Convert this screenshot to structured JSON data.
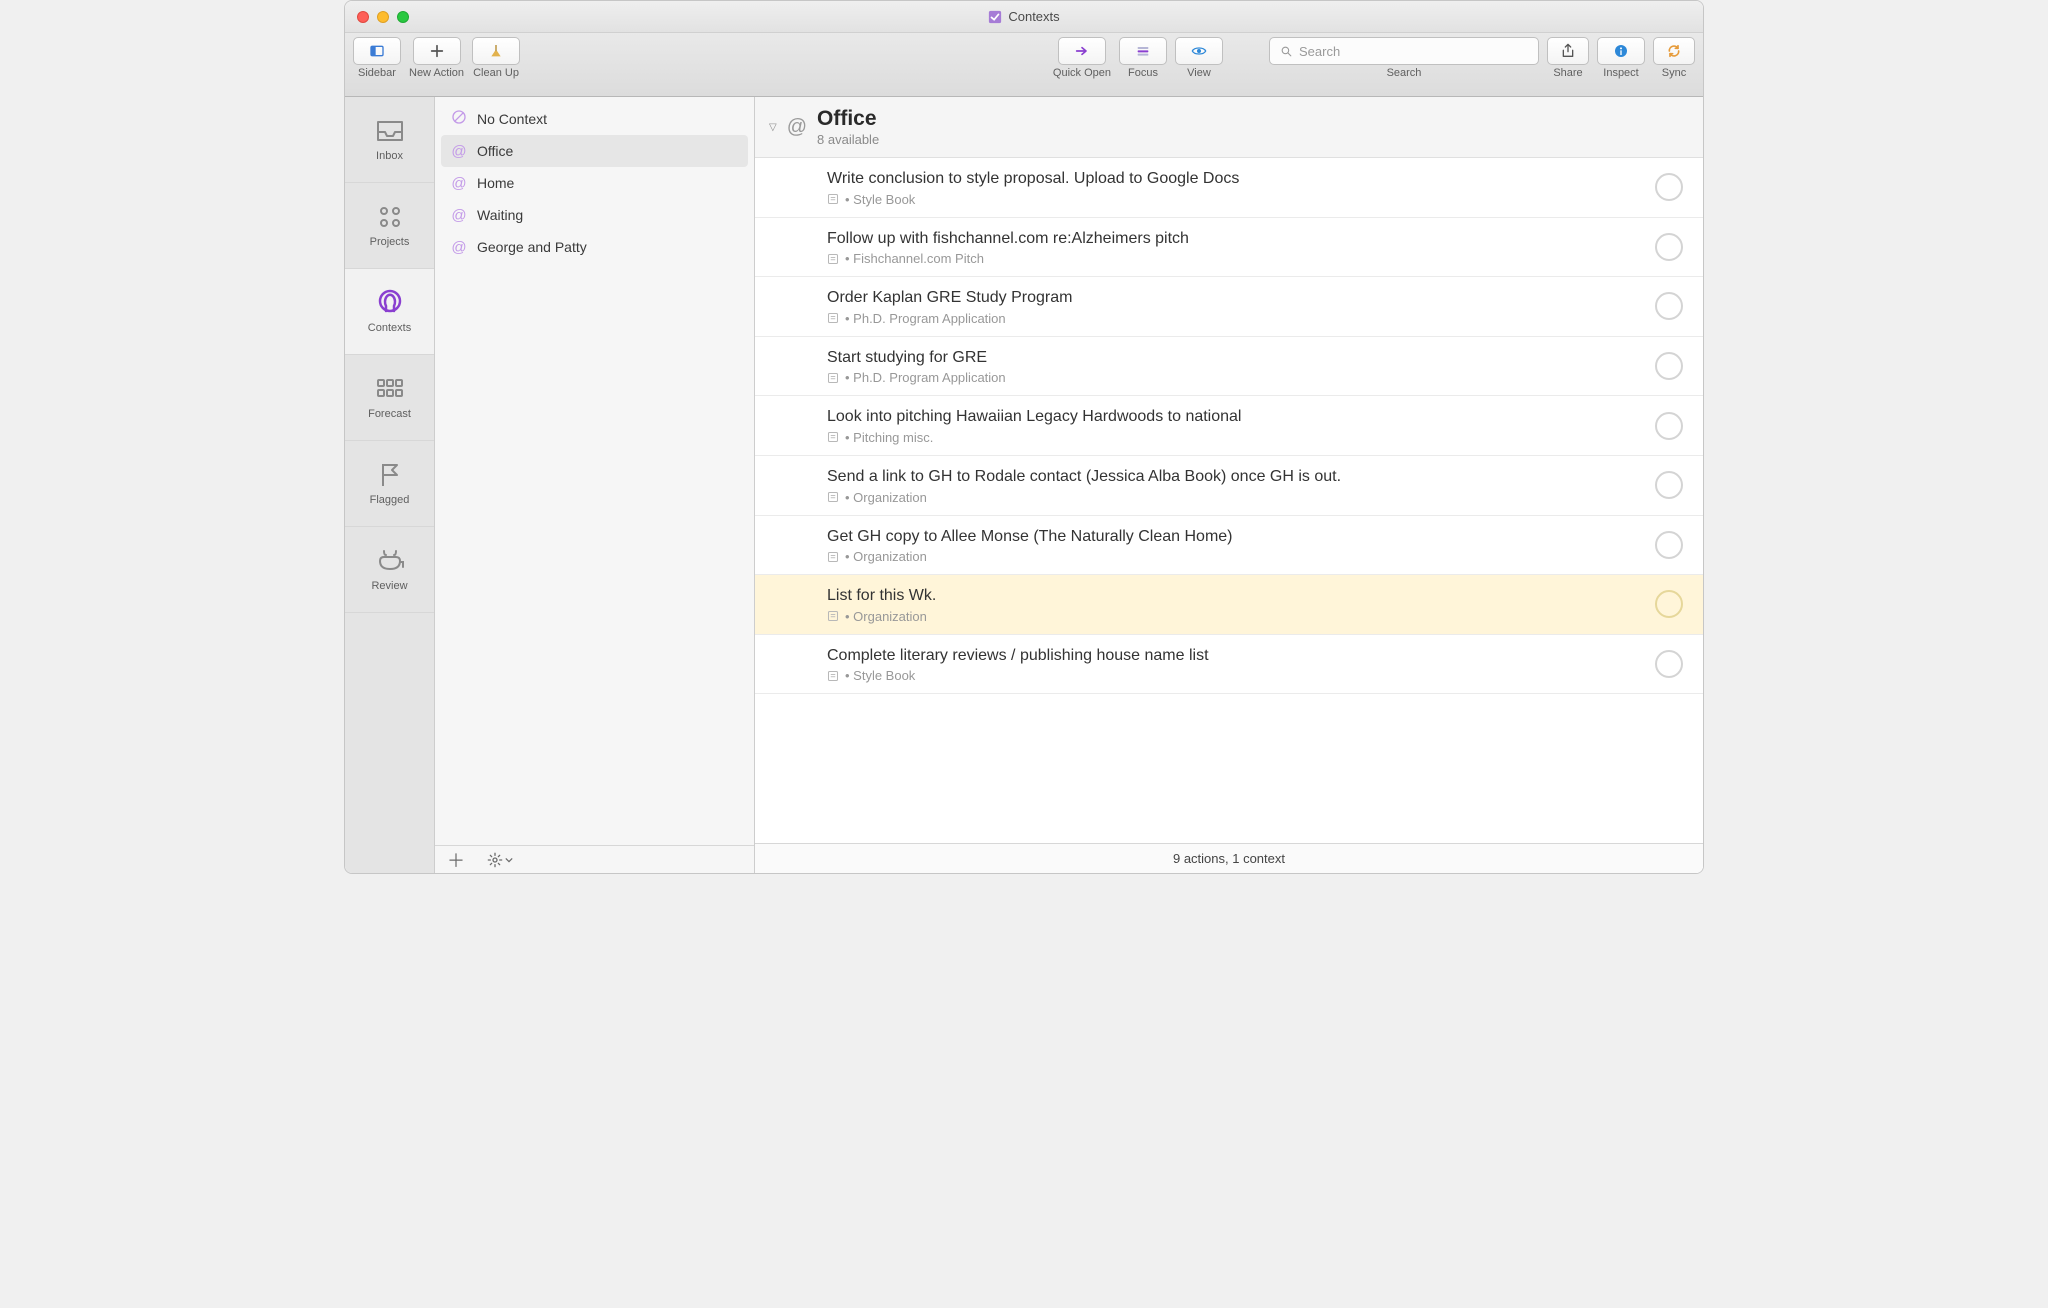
{
  "window": {
    "title": "Contexts"
  },
  "toolbar": {
    "sidebar": "Sidebar",
    "new_action": "New Action",
    "clean_up": "Clean Up",
    "quick_open": "Quick Open",
    "focus": "Focus",
    "view": "View",
    "search_label": "Search",
    "search_placeholder": "Search",
    "share": "Share",
    "inspect": "Inspect",
    "sync": "Sync"
  },
  "rail": {
    "items": [
      {
        "label": "Inbox"
      },
      {
        "label": "Projects"
      },
      {
        "label": "Contexts"
      },
      {
        "label": "Forecast"
      },
      {
        "label": "Flagged"
      },
      {
        "label": "Review"
      }
    ]
  },
  "sidebar": {
    "contexts": [
      {
        "label": "No Context",
        "no_context": true
      },
      {
        "label": "Office",
        "selected": true
      },
      {
        "label": "Home"
      },
      {
        "label": "Waiting"
      },
      {
        "label": "George and Patty"
      }
    ]
  },
  "main": {
    "context_title": "Office",
    "context_subtitle": "8 available",
    "tasks": [
      {
        "title": "Write conclusion to style proposal. Upload to Google Docs",
        "project": "Style Book"
      },
      {
        "title": "Follow up with fishchannel.com re:Alzheimers pitch",
        "project": "Fishchannel.com Pitch"
      },
      {
        "title": "Order Kaplan GRE Study Program",
        "project": "Ph.D. Program Application"
      },
      {
        "title": "Start studying for GRE",
        "project": "Ph.D. Program Application"
      },
      {
        "title": "Look into pitching Hawaiian Legacy Hardwoods to national",
        "project": "Pitching misc."
      },
      {
        "title": "Send a link to GH to Rodale contact (Jessica Alba Book) once GH is out.",
        "project": "Organization"
      },
      {
        "title": "Get GH copy to Allee Monse (The Naturally Clean Home)",
        "project": "Organization"
      },
      {
        "title": "List for this Wk.",
        "project": "Organization",
        "highlighted": true
      },
      {
        "title": "Complete literary reviews / publishing house name list",
        "project": "Style Book"
      }
    ]
  },
  "footer": {
    "status": "9 actions, 1 context"
  }
}
